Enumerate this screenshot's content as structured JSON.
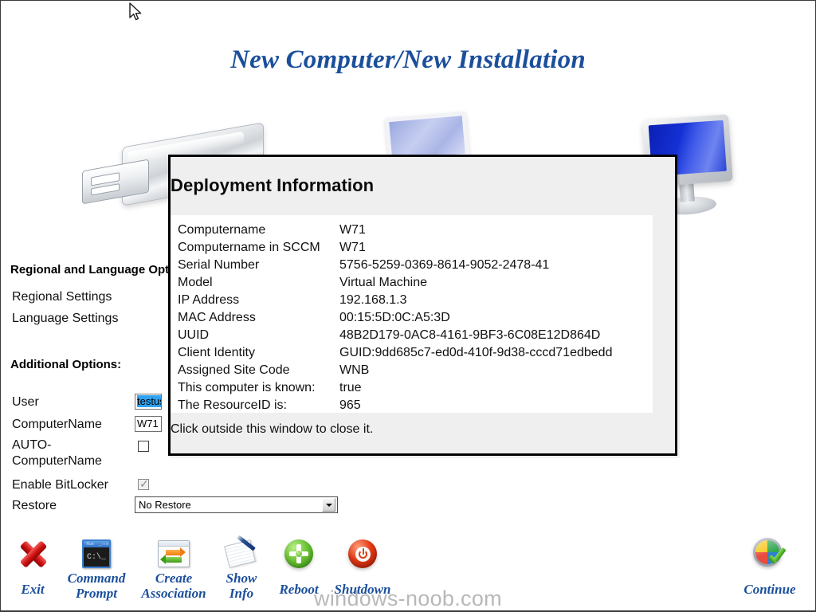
{
  "page": {
    "title": "New Computer/New Installation",
    "watermark": "windows-noob.com",
    "title_color": "#1b4f9c",
    "cursor_icon": "mouse-pointer-icon"
  },
  "left_panel": {
    "regional_heading": "Regional and Language Options:",
    "regional_links": [
      {
        "label": "Regional Settings"
      },
      {
        "label": "Language Settings"
      }
    ],
    "additional_heading": "Additional Options:",
    "fields": [
      {
        "label": "User",
        "value": "testuser",
        "type": "text",
        "selected": true
      },
      {
        "label": "ComputerName",
        "value": "W71",
        "type": "text",
        "selected": false
      },
      {
        "label": "AUTO-\nComputerName",
        "value": "",
        "type": "checkbox",
        "checked": false,
        "disabled": false
      },
      {
        "label": "Enable BitLocker",
        "value": "",
        "type": "checkbox",
        "checked": true,
        "disabled": true
      },
      {
        "label": "Restore",
        "value": "No Restore",
        "type": "select"
      }
    ],
    "restore_options": [
      "No Restore"
    ]
  },
  "dialog": {
    "title": "Deployment Information",
    "hint": "Click outside this window to close it.",
    "rows": [
      {
        "key": "Computername",
        "value": "W71"
      },
      {
        "key": "Computername in SCCM",
        "value": "W71"
      },
      {
        "key": "Serial Number",
        "value": "5756-5259-0369-8614-9052-2478-41"
      },
      {
        "key": "Model",
        "value": "Virtual Machine"
      },
      {
        "key": "IP Address",
        "value": "192.168.1.3"
      },
      {
        "key": "MAC Address",
        "value": "00:15:5D:0C:A5:3D"
      },
      {
        "key": "UUID",
        "value": "48B2D179-0AC8-4161-9BF3-6C08E12D864D"
      },
      {
        "key": "Client Identity",
        "value": "GUID:9dd685c7-ed0d-410f-9d38-cccd71edbedd"
      },
      {
        "key": "Assigned Site Code",
        "value": "WNB"
      },
      {
        "key": "This computer is known:",
        "value": "true"
      },
      {
        "key": "The ResourceID is:",
        "value": "965"
      }
    ]
  },
  "toolbar": {
    "items": [
      {
        "label": "Exit",
        "icon": "red-x-icon"
      },
      {
        "label": "Command\nPrompt",
        "icon": "command-prompt-icon"
      },
      {
        "label": "Create\nAssociation",
        "icon": "create-association-icon"
      },
      {
        "label": "Show\nInfo",
        "icon": "show-info-icon"
      },
      {
        "label": "Reboot",
        "icon": "reboot-icon"
      },
      {
        "label": "Shutdown",
        "icon": "shutdown-icon"
      },
      {
        "label": "Continue",
        "icon": "continue-icon"
      }
    ]
  },
  "background_art": {
    "usb": "usb-flash-drive-image",
    "tablet": "tablet-screen-image",
    "monitor": "lcd-monitor-image"
  }
}
